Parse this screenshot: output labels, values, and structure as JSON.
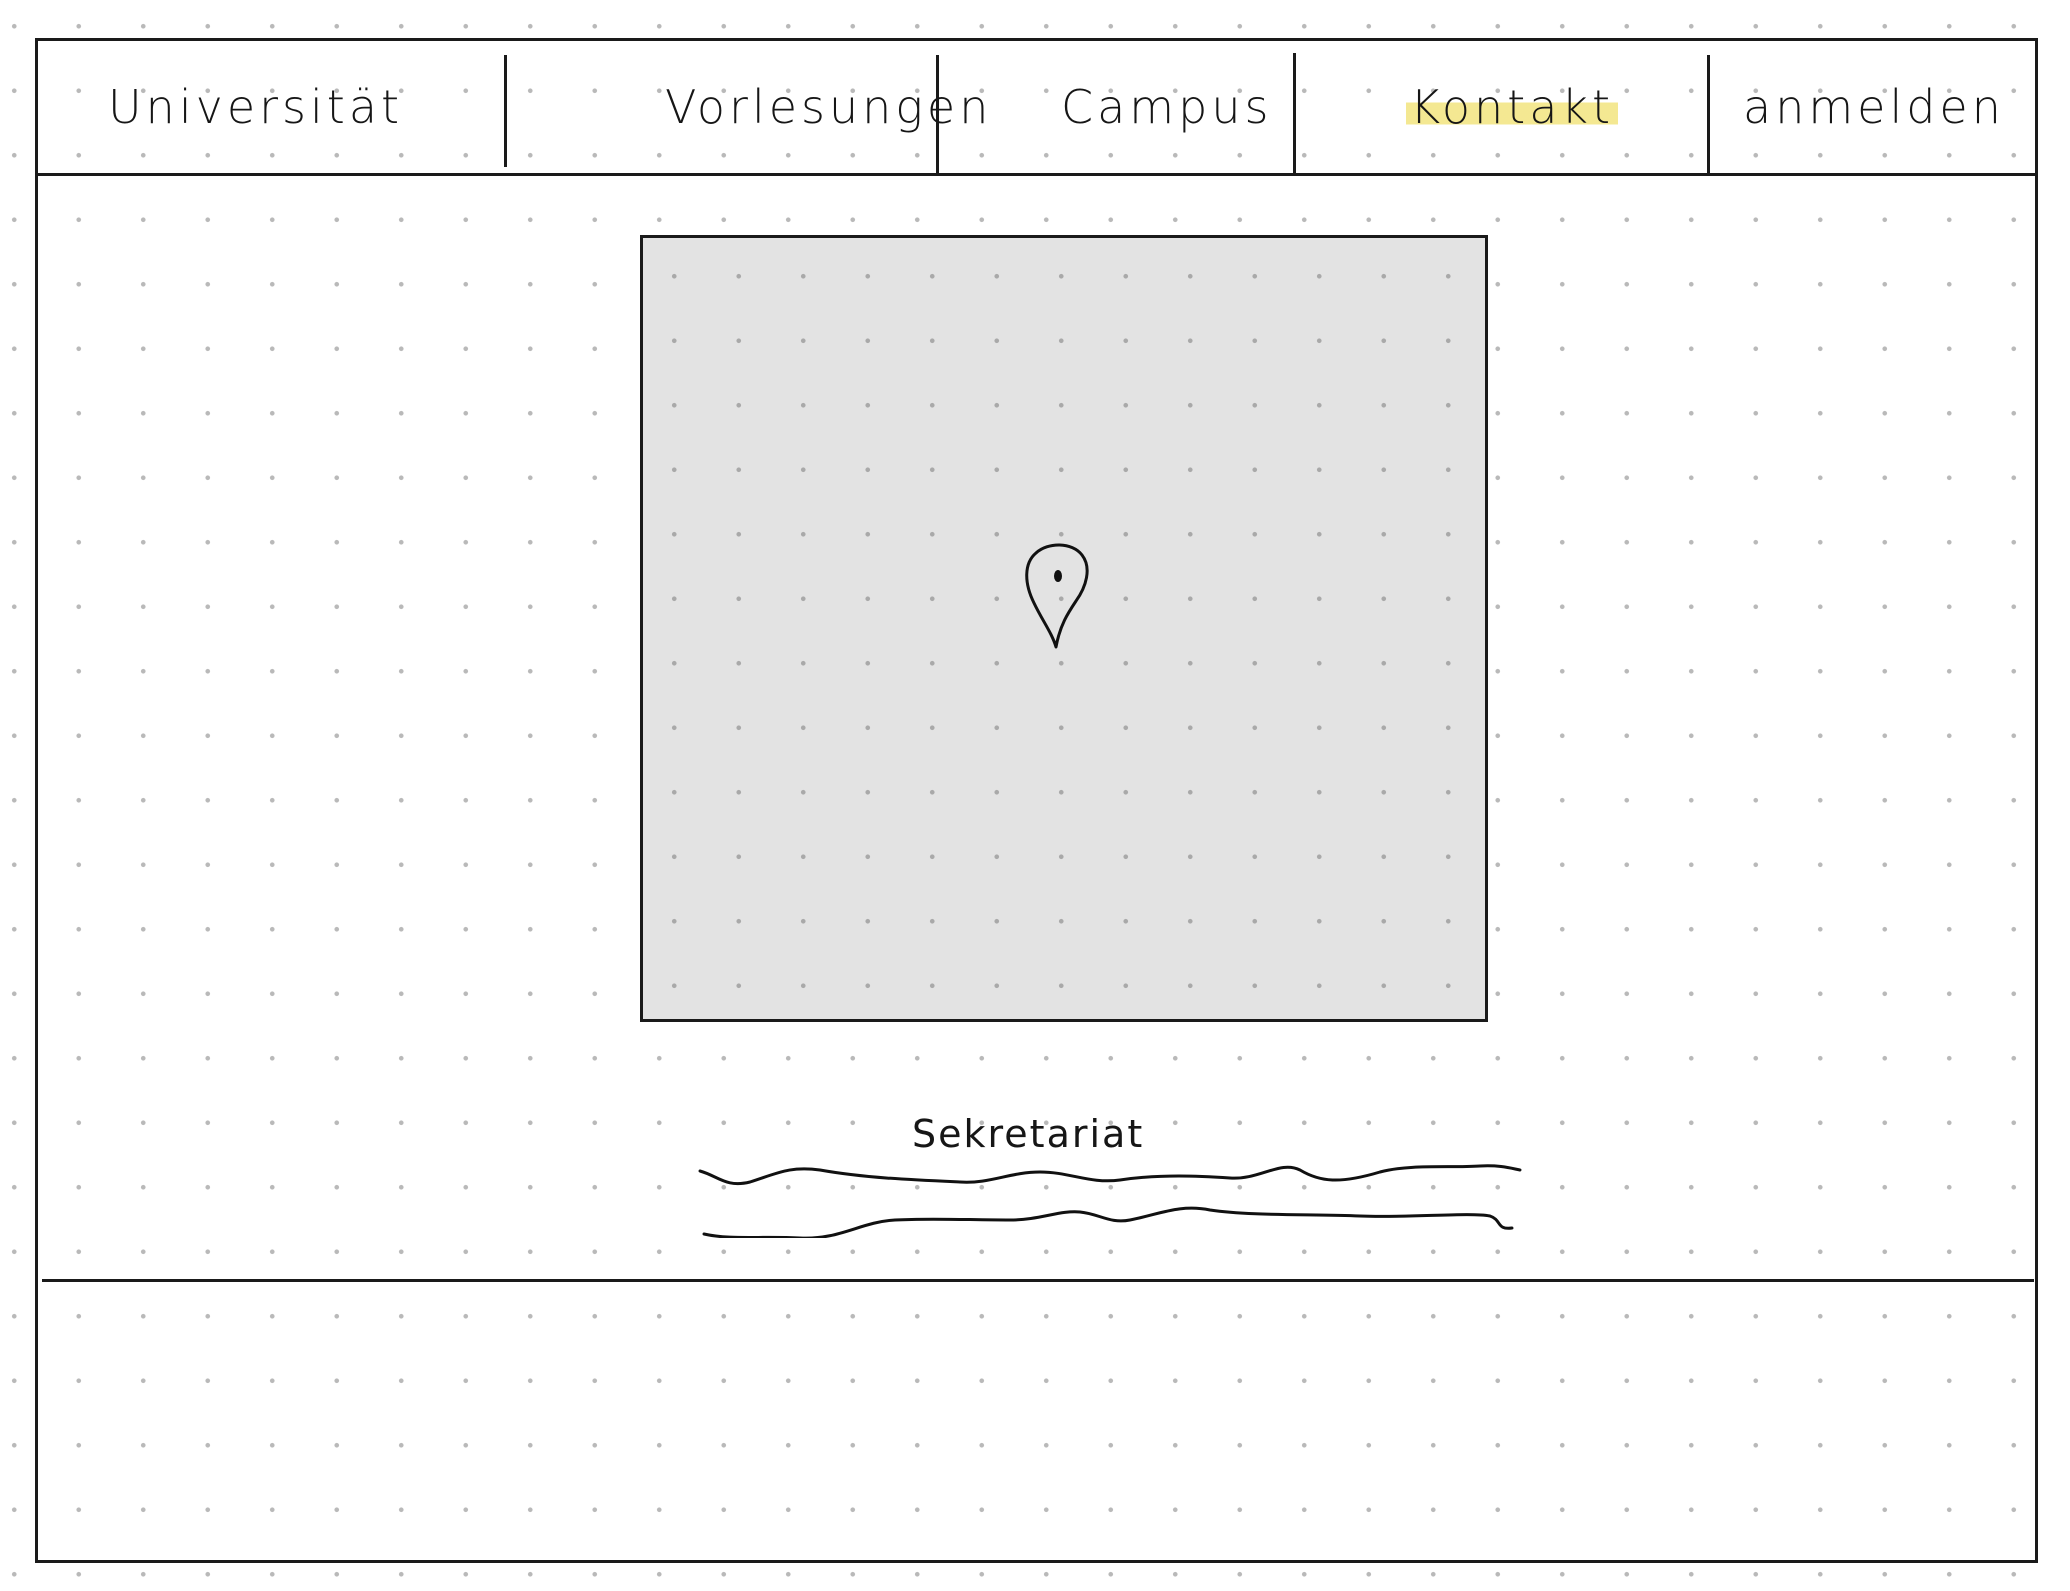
{
  "nav": {
    "brand": "Universität",
    "items": [
      {
        "label": "Vorlesungen"
      },
      {
        "label": "Campus"
      },
      {
        "label": "Kontakt",
        "active": true
      },
      {
        "label": "anmelden"
      }
    ]
  },
  "main": {
    "map": {
      "marker_icon": "map-pin-icon",
      "background_color": "#e3e3e3"
    },
    "contact": {
      "title": "Sekretariat"
    }
  },
  "colors": {
    "stroke": "#1a1a1a",
    "highlight": "#f0e16e"
  }
}
